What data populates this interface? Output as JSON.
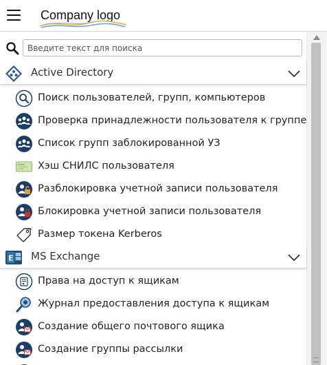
{
  "header": {
    "logo_text": "Company logo"
  },
  "search": {
    "placeholder": "Введите текст для поиска",
    "value": ""
  },
  "groups": [
    {
      "title": "Active Directory",
      "icon": "active-directory-icon",
      "items": [
        {
          "label": "Поиск пользователей, групп, компьютеров",
          "icon": "magnifier-circle-icon"
        },
        {
          "label": "Проверка принадлежности пользователя к группе",
          "icon": "users-group-icon"
        },
        {
          "label": "Список групп заблокированной УЗ",
          "icon": "users-group-icon"
        },
        {
          "label": "Хэш СНИЛС пользователя",
          "icon": "id-card-icon"
        },
        {
          "label": "Разблокировка учетной записи пользователя",
          "icon": "user-unlock-icon"
        },
        {
          "label": "Блокировка учетной записи пользователя",
          "icon": "user-lock-icon"
        },
        {
          "label": "Размер токена Kerberos",
          "icon": "tag-icon"
        }
      ]
    },
    {
      "title": "MS Exchange",
      "icon": "exchange-icon",
      "items": [
        {
          "label": "Права на доступ к ящикам",
          "icon": "mailbox-permissions-icon"
        },
        {
          "label": "Журнал предоставления доступа к ящикам",
          "icon": "search-log-icon"
        },
        {
          "label": "Создание общего почтового ящика",
          "icon": "shared-mailbox-icon"
        },
        {
          "label": "Создание группы рассылки",
          "icon": "distribution-group-icon"
        }
      ]
    }
  ],
  "colors": {
    "icon_blue": "#1f4e79",
    "icon_navy": "#1b3d6d",
    "accent_red": "#c0392b",
    "card_green": "#cfe6b0"
  }
}
